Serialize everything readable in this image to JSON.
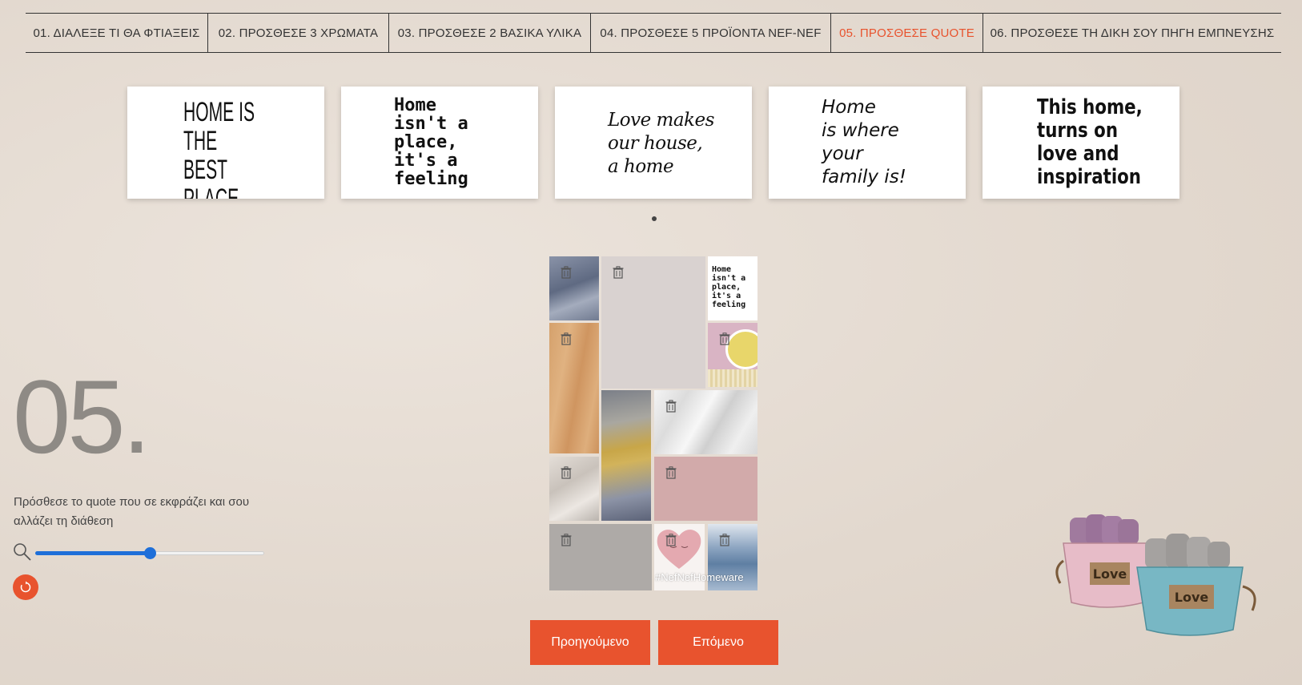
{
  "steps": [
    {
      "label": "01. ΔΙΑΛΕΞΕ ΤΙ ΘΑ ΦΤΙΑΞΕΙΣ"
    },
    {
      "label": "02. ΠΡΟΣΘΕΣΕ 3 ΧΡΩΜΑΤΑ"
    },
    {
      "label": "03. ΠΡΟΣΘΕΣΕ 2 ΒΑΣΙΚΑ ΥΛΙΚΑ"
    },
    {
      "label": "04. ΠΡΟΣΘΕΣΕ 5 ΠΡΟΪΟΝΤΑ NEF-NEF"
    },
    {
      "label": "05. ΠΡΟΣΘΕΣΕ QUOTE",
      "active": true
    },
    {
      "label": "06. ΠΡΟΣΘΕΣΕ ΤΗ ΔΙΚΗ ΣΟΥ ΠΗΓΗ ΕΜΠΝΕΥΣΗΣ"
    }
  ],
  "quotes": [
    {
      "text": "HOME IS THE\nBEST PLACE\nTO BE"
    },
    {
      "text": "Home\nisn't a\nplace,\nit's a\nfeeling"
    },
    {
      "text": "Love makes\nour house,\na home"
    },
    {
      "text": "Home\nis where\nyour\nfamily is!"
    },
    {
      "text": "This home,\nturns on\nlove and\ninspiration"
    }
  ],
  "big_number": "05.",
  "description": "Πρόσθεσε το quote που σε εκφράζει και σου αλλάζει τη διάθεση",
  "zoom": {
    "value": 0.5
  },
  "moodboard": {
    "quote_tile_text": "Home\nisn't a\nplace,\nit's a\nfeeling",
    "hashtag": "#NefNefHomeware"
  },
  "buttons": {
    "prev": "Προηγούμενο",
    "next": "Επόμενο"
  },
  "colors": {
    "accent": "#e8532e",
    "slider": "#1e6fd9",
    "background": "#e6ddd4"
  },
  "icons": {
    "zoom": "magnifier-icon",
    "reset": "refresh-icon",
    "delete": "trash-icon"
  }
}
